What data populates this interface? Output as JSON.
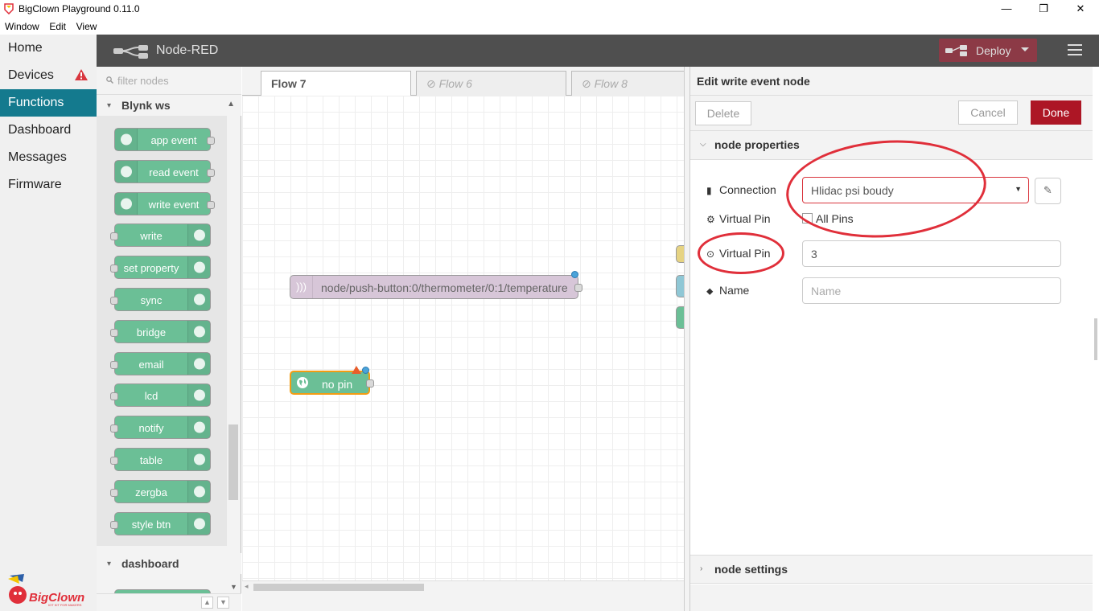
{
  "window": {
    "title": "BigClown Playground 0.11.0",
    "minimize_glyph": "—",
    "restore_glyph": "❐",
    "close_glyph": "✕"
  },
  "menubar": [
    "Window",
    "Edit",
    "View"
  ],
  "app_sidebar": {
    "items": [
      {
        "label": "Home"
      },
      {
        "label": "Devices",
        "warning": true
      },
      {
        "label": "Functions",
        "active": true
      },
      {
        "label": "Dashboard"
      },
      {
        "label": "Messages"
      },
      {
        "label": "Firmware"
      }
    ],
    "logo_text": "BigClown",
    "logo_tagline": "IOT KIT FOR MAKERS"
  },
  "header": {
    "title": "Node-RED",
    "deploy_label": "Deploy"
  },
  "palette": {
    "filter_placeholder": "filter nodes",
    "category": "Blynk ws",
    "category2": "dashboard",
    "nodes": [
      {
        "label": "app event",
        "icon": "globe-icon"
      },
      {
        "label": "read event",
        "icon": "globe-icon"
      },
      {
        "label": "write event",
        "icon": "globe-icon"
      },
      {
        "label": "write",
        "icon": "globe-icon"
      },
      {
        "label": "set property",
        "icon": "globe-icon"
      },
      {
        "label": "sync",
        "icon": "wifi-icon"
      },
      {
        "label": "bridge",
        "icon": "bridge-icon"
      },
      {
        "label": "email",
        "icon": "envelope-icon"
      },
      {
        "label": "lcd",
        "icon": "lcd-icon"
      },
      {
        "label": "notify",
        "icon": "phone-icon"
      },
      {
        "label": "table",
        "icon": "table-icon"
      },
      {
        "label": "zergba",
        "icon": "zergba-icon"
      },
      {
        "label": "style btn",
        "icon": "button-icon"
      }
    ]
  },
  "workspace": {
    "tabs": [
      {
        "label": "Flow 7",
        "active": true
      },
      {
        "label": "Flow 6",
        "disabled": true
      },
      {
        "label": "Flow 8",
        "disabled": true
      }
    ],
    "nodes": [
      {
        "label": "node/push-button:0/thermometer/0:1/temperature",
        "type": "mqtt in"
      },
      {
        "label": "no pin",
        "type": "write event"
      }
    ]
  },
  "tray": {
    "title": "Edit write event node",
    "delete_label": "Delete",
    "cancel_label": "Cancel",
    "done_label": "Done",
    "section_properties": "node properties",
    "section_settings": "node settings",
    "connection_label": "Connection",
    "connection_value": "Hlidac psi boudy",
    "virtual_pin_label": "Virtual Pin",
    "all_pins_label": "All Pins",
    "virtual_pin2_label": "Virtual Pin",
    "virtual_pin_value": "3",
    "name_label": "Name",
    "name_placeholder": "Name"
  },
  "colors": {
    "header_bg": "#4f4f4f",
    "active_sidebar": "#147a8e",
    "node_green": "#6bbf96",
    "mqtt_purple": "#d8bfd8",
    "done_red": "#ad1625",
    "annotation_red": "#e02f3a"
  }
}
